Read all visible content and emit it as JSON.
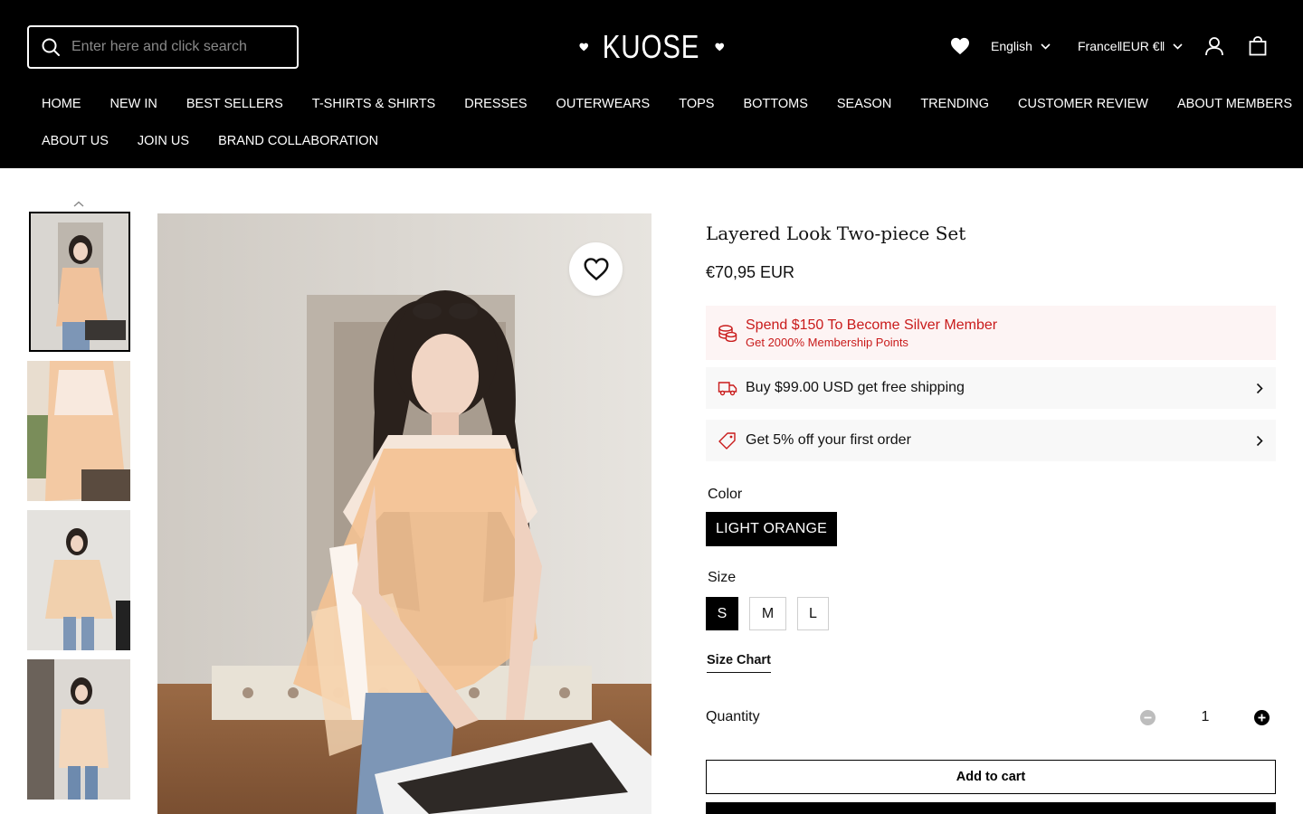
{
  "header": {
    "search_placeholder": "Enter here and click search",
    "logo": "KUOSE",
    "language": "English",
    "currency": "France‖EUR €‖",
    "nav_row1": [
      "HOME",
      "NEW IN",
      "BEST SELLERS",
      "T-SHIRTS & SHIRTS",
      "DRESSES",
      "OUTERWEARS",
      "TOPS",
      "BOTTOMS",
      "SEASON",
      "TRENDING",
      "CUSTOMER REVIEW",
      "ABOUT MEMBERS"
    ],
    "nav_row2": [
      "ABOUT US",
      "JOIN US",
      "BRAND COLLABORATION"
    ]
  },
  "product": {
    "title": "Layered Look Two-piece Set",
    "price": "€70,95 EUR",
    "promos": {
      "member_title": "Spend $150 To Become Silver Member",
      "member_sub": "Get 2000% Membership Points",
      "shipping": "Buy $99.00 USD get free shipping",
      "first_order": "Get 5% off your first order"
    },
    "color_label": "Color",
    "color_value": "LIGHT ORANGE",
    "size_label": "Size",
    "sizes": [
      "S",
      "M",
      "L"
    ],
    "selected_size": "S",
    "size_chart": "Size Chart",
    "quantity_label": "Quantity",
    "quantity": "1",
    "add_to_cart": "Add to cart"
  },
  "icons": [
    "search-icon",
    "heart-icon",
    "chevron-down-icon",
    "user-icon",
    "bag-icon",
    "chevron-up-icon",
    "coins-icon",
    "truck-icon",
    "tag-icon",
    "chevron-right-icon",
    "minus-circle-icon",
    "plus-circle-icon"
  ],
  "colors": {
    "header_bg": "#000000",
    "member_red": "#c91b1b",
    "promo_bg": "#f8f8f8"
  }
}
